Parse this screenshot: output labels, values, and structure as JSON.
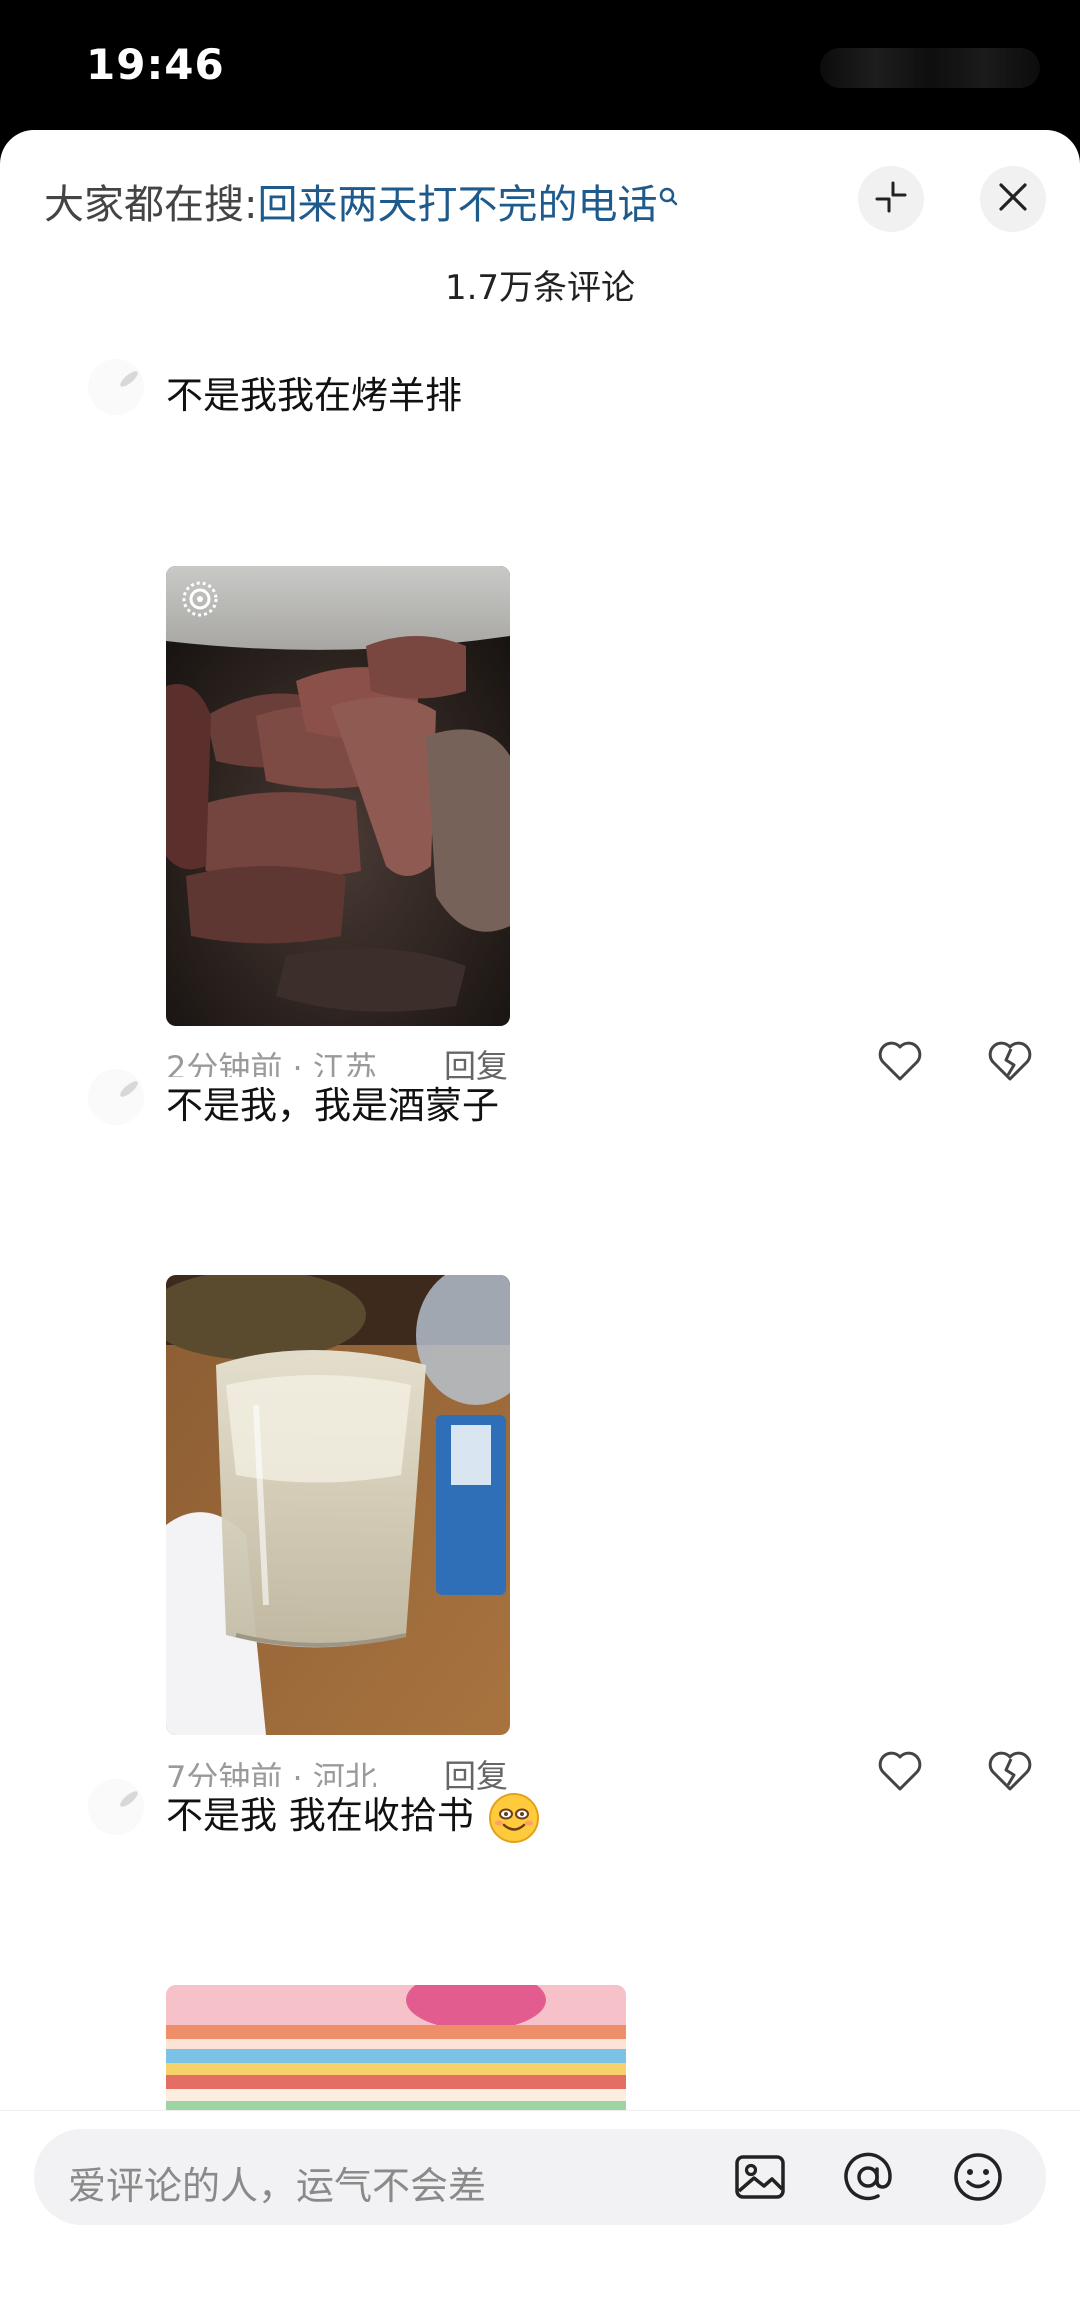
{
  "status_bar": {
    "time": "19:46"
  },
  "header": {
    "search_prefix": "大家都在搜:",
    "search_query": "回来两天打不完的电话",
    "icons": {
      "search": "search-icon",
      "collapse": "collapse-icon",
      "close": "close-icon"
    }
  },
  "comment_count": "1.7万条评论",
  "comments": [
    {
      "text": "不是我我在烤羊排",
      "image": "grilled-lamb-ribs-photo",
      "time_location": "2分钟前 · 江苏",
      "reply_label": "回复"
    },
    {
      "text": "不是我，我是酒蒙子",
      "image": "glass-of-liquor-photo",
      "time_location": "7分钟前 · 河北",
      "reply_label": "回复"
    },
    {
      "text": "不是我 我在收拾书",
      "emoji": "smiling-emoji",
      "image": "stack-of-books-photo"
    }
  ],
  "input": {
    "placeholder": "爱评论的人，运气不会差",
    "icons": [
      "image-icon",
      "at-icon",
      "emoji-icon"
    ]
  }
}
